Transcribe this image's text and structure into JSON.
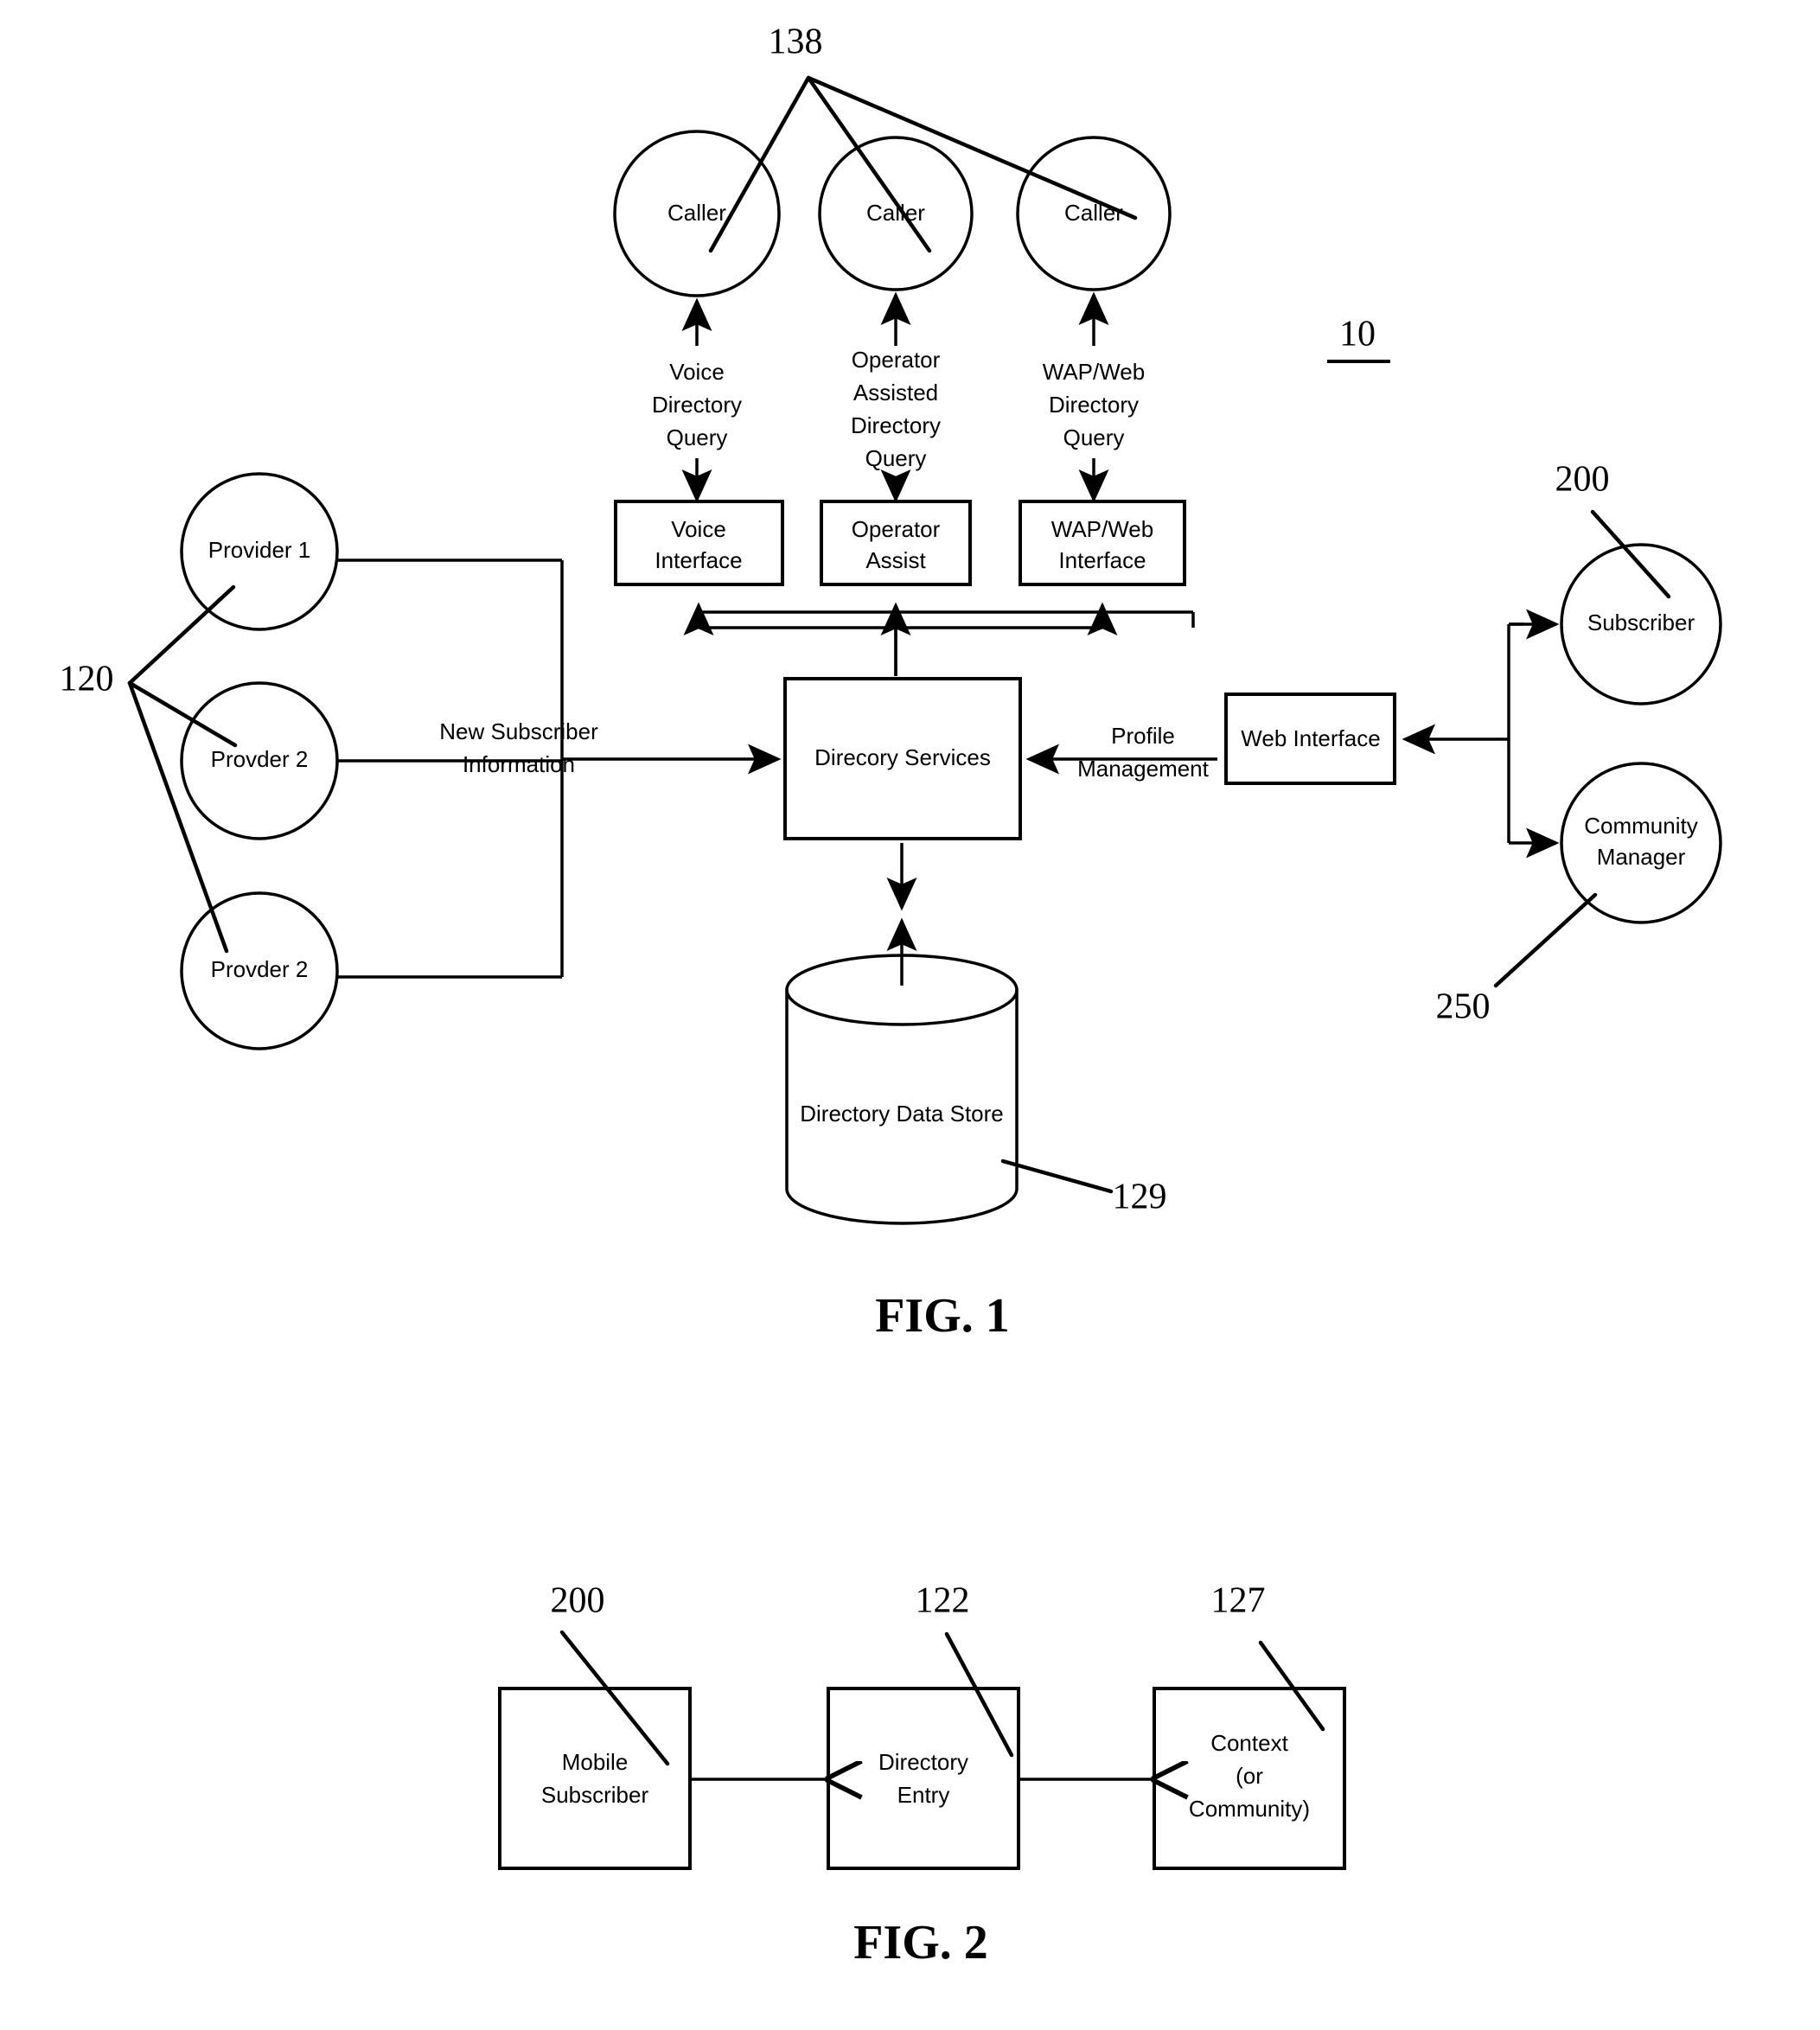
{
  "document": {
    "type": "patent-drawing-sheet",
    "background_color": "#ffffff",
    "ink_color": "#000000"
  },
  "figure1": {
    "caption": "FIG. 1",
    "system_ref": "10",
    "callers": {
      "ref": "138",
      "nodes": [
        {
          "label": "Caller"
        },
        {
          "label": "Caller"
        },
        {
          "label": "Caller"
        }
      ]
    },
    "query_labels": [
      {
        "line1": "Voice",
        "line2": "Directory",
        "line3": "Query",
        "line4": ""
      },
      {
        "line1": "Operator",
        "line2": "Assisted",
        "line3": "Directory",
        "line4": "Query"
      },
      {
        "line1": "WAP/Web",
        "line2": "Directory",
        "line3": "Query",
        "line4": ""
      }
    ],
    "interfaces": [
      {
        "line1": "Voice",
        "line2": "Interface"
      },
      {
        "line1": "Operator",
        "line2": "Assist"
      },
      {
        "line1": "WAP/Web",
        "line2": "Interface"
      }
    ],
    "providers": {
      "ref": "120",
      "nodes": [
        {
          "label": "Provider 1"
        },
        {
          "label": "Provder 2"
        },
        {
          "label": "Provder 2"
        }
      ]
    },
    "provider_edge_label": {
      "line1": "New Subscriber",
      "line2": "Information"
    },
    "directory_services": {
      "label": "Direcory Services"
    },
    "profile_edge_label": {
      "line1": "Profile",
      "line2": "Management"
    },
    "web_interface": {
      "label": "Web Interface"
    },
    "subscriber": {
      "label": "Subscriber",
      "ref": "200"
    },
    "community_manager": {
      "line1": "Community",
      "line2": "Manager",
      "ref": "250"
    },
    "data_store": {
      "label": "Directory Data Store",
      "ref": "129"
    }
  },
  "figure2": {
    "caption": "FIG. 2",
    "entities": [
      {
        "line1": "Mobile",
        "line2": "Subscriber",
        "line3": "",
        "ref": "200"
      },
      {
        "line1": "Directory",
        "line2": "Entry",
        "line3": "",
        "ref": "122"
      },
      {
        "line1": "Context",
        "line2": "(or",
        "line3": "Community)",
        "ref": "127"
      }
    ]
  }
}
